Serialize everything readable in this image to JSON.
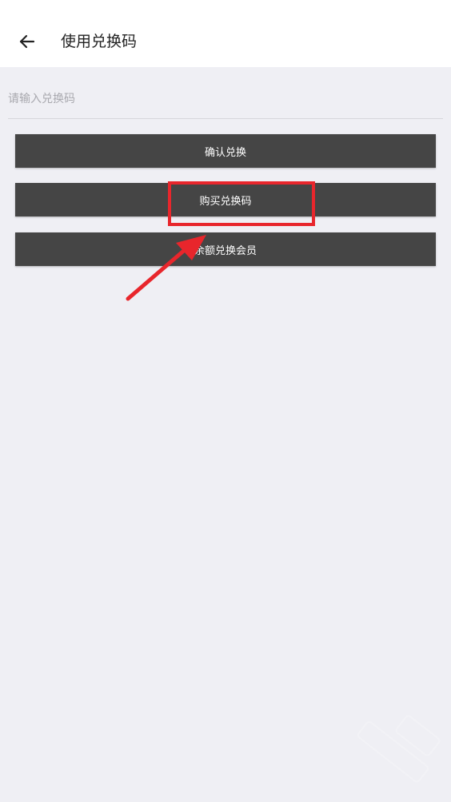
{
  "header": {
    "back_icon": "arrow-left-icon",
    "title": "使用兑换码"
  },
  "form": {
    "code_placeholder": "请输入兑换码",
    "code_value": ""
  },
  "buttons": {
    "confirm_label": "确认兑换",
    "buy_label": "购买兑换码",
    "balance_label": "余额兑换会员"
  },
  "annotations": {
    "highlight_color": "#e8262c",
    "arrow_color": "#e8262c"
  },
  "colors": {
    "background": "#efeff4",
    "header_background": "#ffffff",
    "button_background": "#454545",
    "button_text": "#ffffff"
  }
}
